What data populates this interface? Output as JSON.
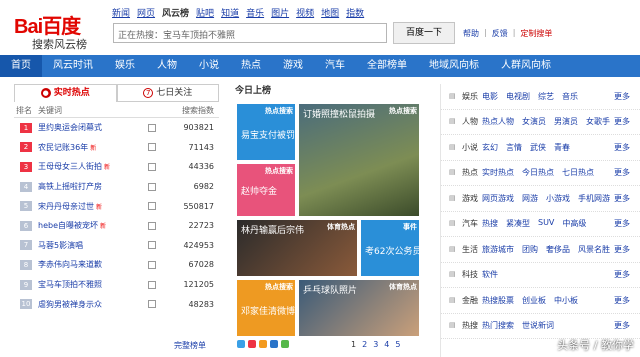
{
  "logo": {
    "brand": "Bai百度",
    "sub": "搜索风云榜"
  },
  "topnav": [
    "新闻",
    "网页",
    "风云榜",
    "贴吧",
    "知道",
    "音乐",
    "图片",
    "视频",
    "地图",
    "指数"
  ],
  "search": {
    "value": "正在热搜：宝马车顶拍不雅照",
    "button": "百度一下"
  },
  "help_links": {
    "help": "帮助",
    "feedback": "反馈",
    "custom": "定制搜单"
  },
  "mainnav": [
    "首页",
    "风云时讯",
    "娱乐",
    "人物",
    "小说",
    "热点",
    "游戏",
    "汽车",
    "全部榜单",
    "地域风向标",
    "人群风向标"
  ],
  "left": {
    "tab_realtime": "实时热点",
    "tab_week": "七日关注",
    "col_rank": "排名",
    "col_keyword": "关键词",
    "col_index": "搜索指数",
    "new_tag": "新",
    "rows": [
      {
        "rank": "1",
        "kw": "里约奥运会闭幕式",
        "new": false,
        "num": "903821"
      },
      {
        "rank": "2",
        "kw": "农民记账36年",
        "new": true,
        "num": "71143"
      },
      {
        "rank": "3",
        "kw": "王母母女三人街拍",
        "new": true,
        "num": "44336"
      },
      {
        "rank": "4",
        "kw": "高铁上摇啦打产房",
        "new": false,
        "num": "6982"
      },
      {
        "rank": "5",
        "kw": "宋丹丹母亲过世",
        "new": true,
        "num": "550817"
      },
      {
        "rank": "6",
        "kw": "hebe自曝被宠坏",
        "new": true,
        "num": "22723"
      },
      {
        "rank": "7",
        "kw": "马蓉5影演唱",
        "new": false,
        "num": "424953"
      },
      {
        "rank": "8",
        "kw": "李赤伟向马来道歉",
        "new": false,
        "num": "67028"
      },
      {
        "rank": "9",
        "kw": "宝马车顶拍不雅照",
        "new": false,
        "num": "121205"
      },
      {
        "rank": "10",
        "kw": "虐狗男被禅身示众",
        "new": false,
        "num": "48283"
      }
    ],
    "more": "完整榜单"
  },
  "center": {
    "title": "今日上榜",
    "cards": [
      {
        "tag": "热点搜索",
        "text": "易宝支付被罚"
      },
      {
        "tag": "热点搜索",
        "text": "订婚照撞松鼠拍摄"
      },
      {
        "tag": "热点搜索",
        "text": "赵帅夺金"
      },
      {
        "tag": "体育热点",
        "text": "林丹输赢后宗伟"
      },
      {
        "tag": "事件",
        "text": "考62次公务员"
      },
      {
        "tag": "热点搜索",
        "text": "邓家佳清微博"
      },
      {
        "tag": "体育热点",
        "text": "乒乓球队照片"
      }
    ],
    "pages": [
      "1",
      "2",
      "3",
      "4",
      "5"
    ]
  },
  "right": {
    "more": "更多",
    "rows": [
      {
        "cat": "娱乐",
        "items": [
          "电影",
          "电视剧",
          "综艺",
          "音乐"
        ]
      },
      {
        "cat": "人物",
        "items": [
          "热点人物",
          "女演员",
          "男演员",
          "女歌手"
        ]
      },
      {
        "cat": "小说",
        "items": [
          "玄幻",
          "言情",
          "武侠",
          "青春"
        ]
      },
      {
        "cat": "热点",
        "items": [
          "实时热点",
          "今日热点",
          "七日热点"
        ]
      },
      {
        "cat": "游戏",
        "items": [
          "网页游戏",
          "网游",
          "小游戏",
          "手机网游"
        ]
      },
      {
        "cat": "汽车",
        "items": [
          "热搜",
          "紧凑型",
          "SUV",
          "中高级"
        ]
      },
      {
        "cat": "生活",
        "items": [
          "旅游城市",
          "团购",
          "奢侈品",
          "风景名胜"
        ]
      },
      {
        "cat": "科技",
        "items": [
          "软件"
        ]
      },
      {
        "cat": "金融",
        "items": [
          "热搜股票",
          "创业板",
          "中小板"
        ]
      },
      {
        "cat": "热搜",
        "items": [
          "热门搜索",
          "世说新词"
        ]
      }
    ]
  },
  "watermark": "头条号 / 教你学"
}
